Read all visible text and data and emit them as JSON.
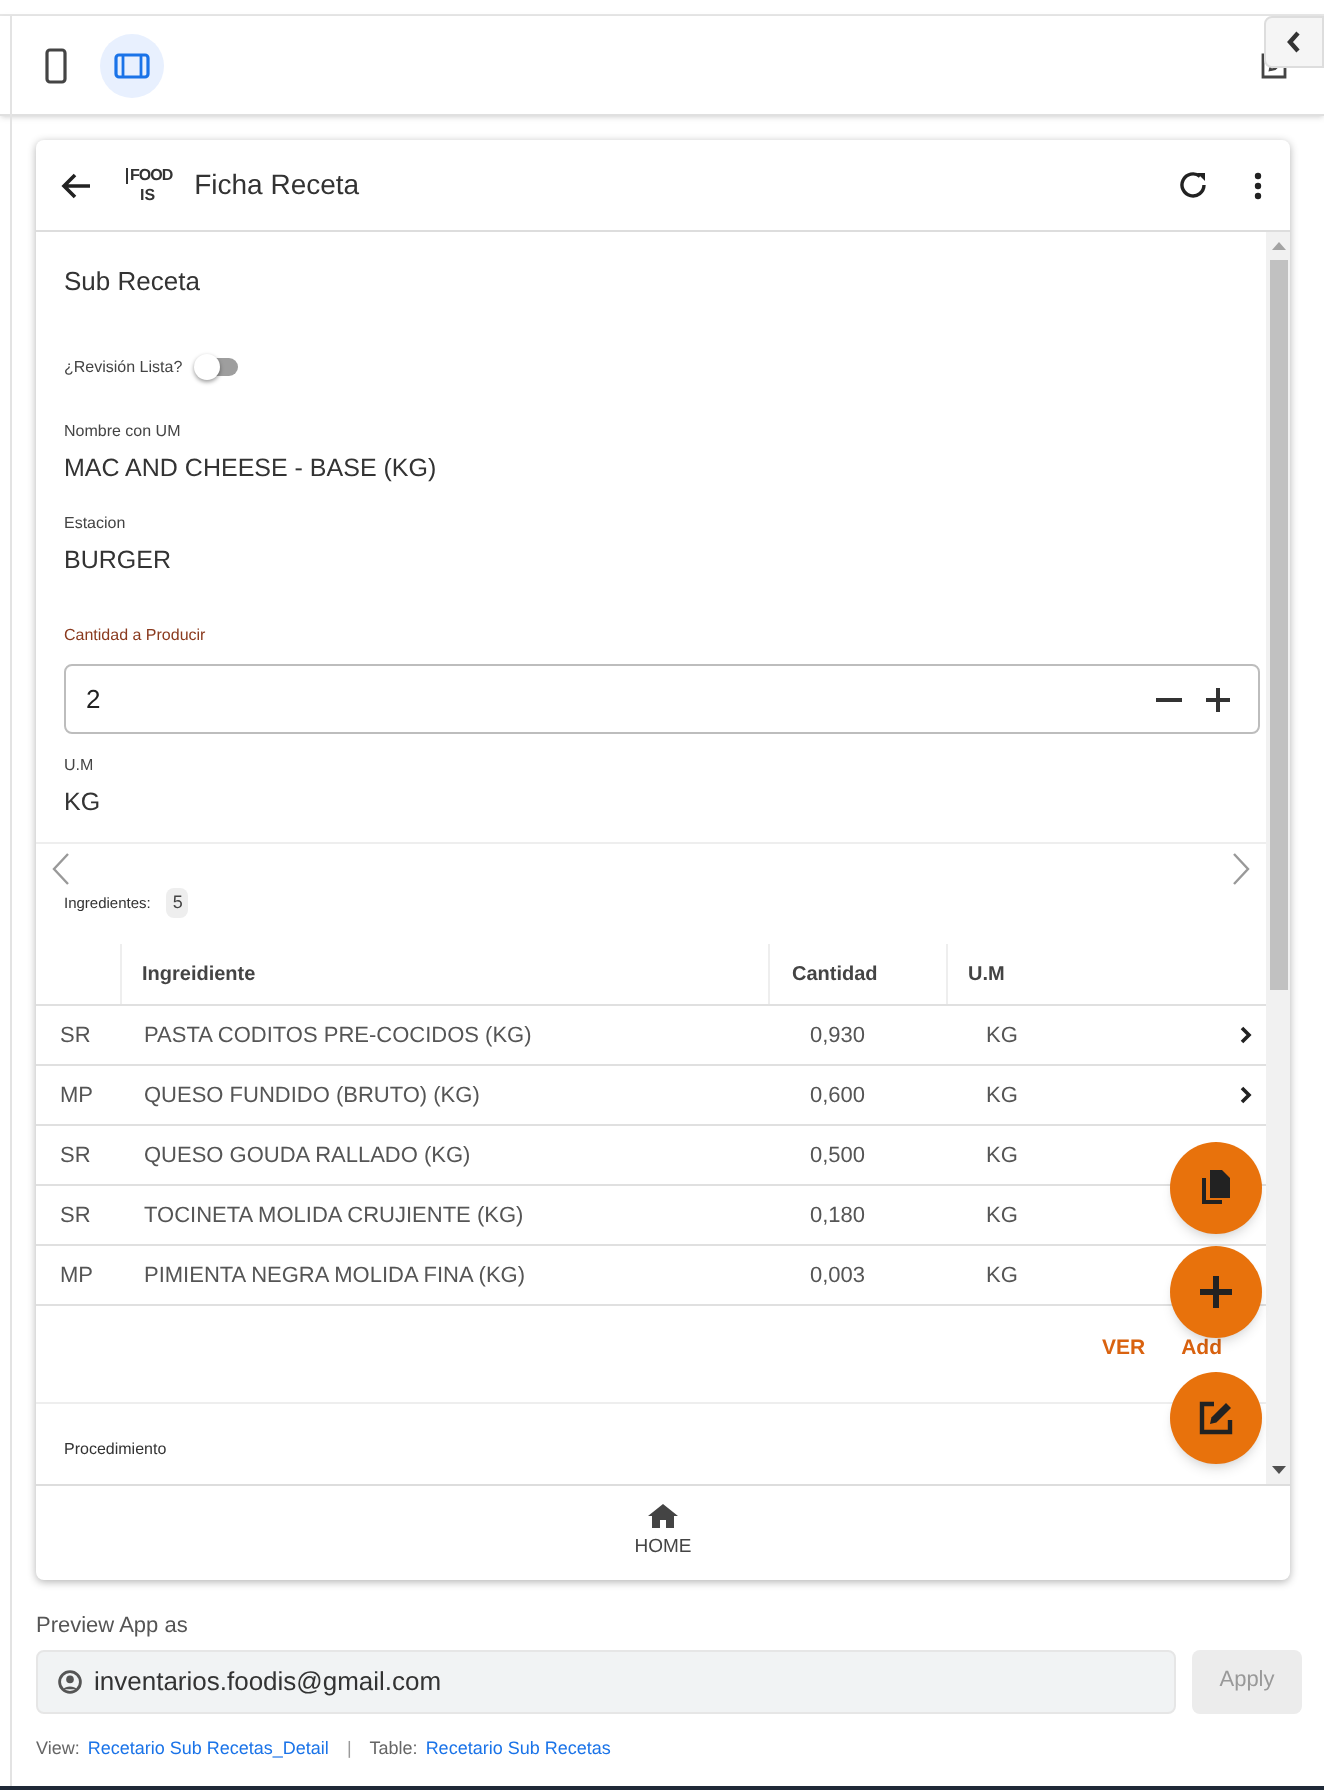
{
  "toolbar": {
    "view_modes": [
      {
        "kind": "phone",
        "selected": false
      },
      {
        "kind": "tablet",
        "selected": true
      }
    ]
  },
  "app": {
    "title": "Ficha Receta",
    "logo_text": "FOOD",
    "logo_suffix": "IS"
  },
  "section_title": "Sub Receta",
  "review_toggle": {
    "label": "¿Revisión Lista?",
    "on": false
  },
  "fields": [
    {
      "label": "Nombre con UM",
      "value": "MAC AND CHEESE - BASE (KG)"
    },
    {
      "label": "Estacion",
      "value": "BURGER"
    }
  ],
  "quantity": {
    "label": "Cantidad a Producir",
    "value": "2"
  },
  "um": {
    "label": "U.M",
    "value": "KG"
  },
  "ingredients": {
    "label": "Ingredientes:",
    "count": "5",
    "columns": [
      "Ingreidiente",
      "Cantidad",
      "U.M"
    ],
    "rows": [
      {
        "type": "SR",
        "name": "PASTA CODITOS PRE-COCIDOS (KG)",
        "quantity": "0,930",
        "unit": "KG",
        "chevron": true
      },
      {
        "type": "MP",
        "name": "QUESO FUNDIDO (BRUTO) (KG)",
        "quantity": "0,600",
        "unit": "KG",
        "chevron": true
      },
      {
        "type": "SR",
        "name": "QUESO GOUDA RALLADO (KG)",
        "quantity": "0,500",
        "unit": "KG",
        "chevron": false
      },
      {
        "type": "SR",
        "name": "TOCINETA MOLIDA CRUJIENTE (KG)",
        "quantity": "0,180",
        "unit": "KG",
        "chevron": false
      },
      {
        "type": "MP",
        "name": "PIMIENTA NEGRA MOLIDA FINA (KG)",
        "quantity": "0,003",
        "unit": "KG",
        "chevron": false
      }
    ]
  },
  "actions": [
    "VER",
    "Add"
  ],
  "procedure": {
    "label": "Procedimiento"
  },
  "nav": {
    "label": "HOME"
  },
  "preview": {
    "label": "Preview App as",
    "email": "inventarios.foodis@gmail.com",
    "button": "Apply"
  },
  "footer": {
    "view_label": "View:",
    "view": "Recetario Sub Recetas_Detail",
    "separator": "|",
    "table_label": "Table:",
    "table": "Recetario Sub Recetas"
  }
}
